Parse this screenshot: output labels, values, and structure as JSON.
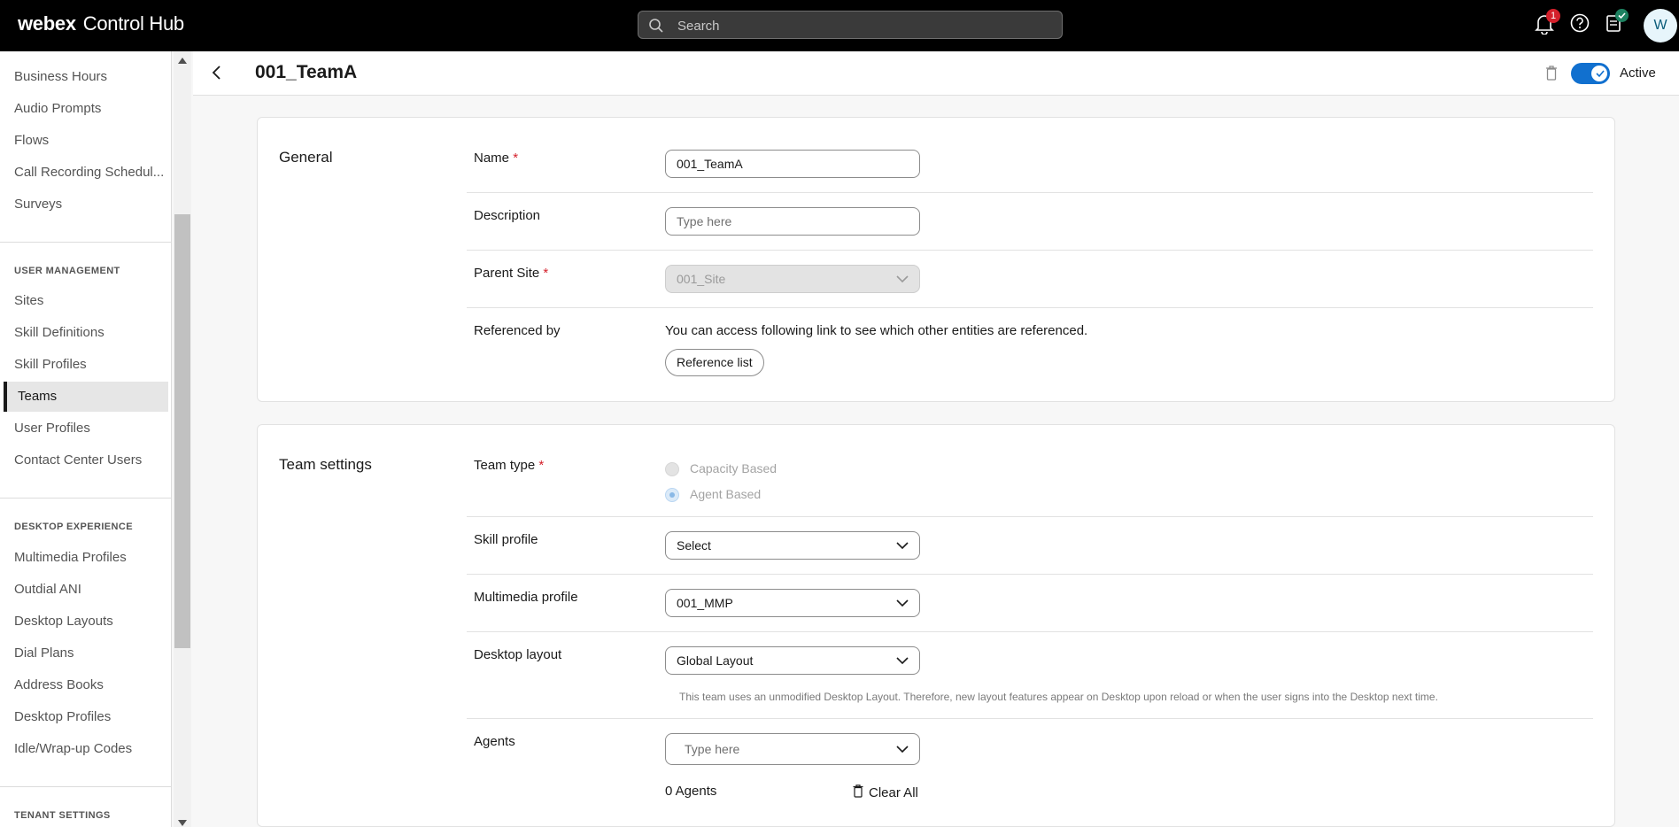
{
  "app": {
    "brand": "webex",
    "product": "Control Hub"
  },
  "search": {
    "placeholder": "Search"
  },
  "header": {
    "notification_count": "1",
    "avatar_initial": "W"
  },
  "sidebar": {
    "items_top": [
      "Business Hours",
      "Audio Prompts",
      "Flows",
      "Call Recording Schedul...",
      "Surveys"
    ],
    "section_user": "USER MANAGEMENT",
    "items_user": [
      "Sites",
      "Skill Definitions",
      "Skill Profiles",
      "Teams",
      "User Profiles",
      "Contact Center Users"
    ],
    "active_item": "Teams",
    "section_desktop": "DESKTOP EXPERIENCE",
    "items_desktop": [
      "Multimedia Profiles",
      "Outdial ANI",
      "Desktop Layouts",
      "Dial Plans",
      "Address Books",
      "Desktop Profiles",
      "Idle/Wrap-up Codes"
    ],
    "section_tenant": "TENANT SETTINGS"
  },
  "page": {
    "title": "001_TeamA",
    "status_label": "Active",
    "active": true
  },
  "general": {
    "title": "General",
    "name_label": "Name",
    "name_value": "001_TeamA",
    "description_label": "Description",
    "description_placeholder": "Type here",
    "parent_site_label": "Parent Site",
    "parent_site_value": "001_Site",
    "referenced_by_label": "Referenced by",
    "referenced_by_text": "You can access following link to see which other entities are referenced.",
    "reference_button": "Reference list"
  },
  "team_settings": {
    "title": "Team settings",
    "team_type_label": "Team type",
    "team_type_options": [
      "Capacity Based",
      "Agent Based"
    ],
    "team_type_selected": "Agent Based",
    "skill_profile_label": "Skill profile",
    "skill_profile_value": "Select",
    "multimedia_profile_label": "Multimedia profile",
    "multimedia_profile_value": "001_MMP",
    "desktop_layout_label": "Desktop layout",
    "desktop_layout_value": "Global Layout",
    "desktop_layout_note": "This team uses an unmodified Desktop Layout. Therefore, new layout features appear on Desktop upon reload or when the user signs into the Desktop next time.",
    "agents_label": "Agents",
    "agents_placeholder": "Type here",
    "agents_count": "0 Agents",
    "clear_all": "Clear All"
  },
  "colors": {
    "accent": "#1170cf",
    "required": "#d4202b",
    "topbar": "#000000"
  }
}
